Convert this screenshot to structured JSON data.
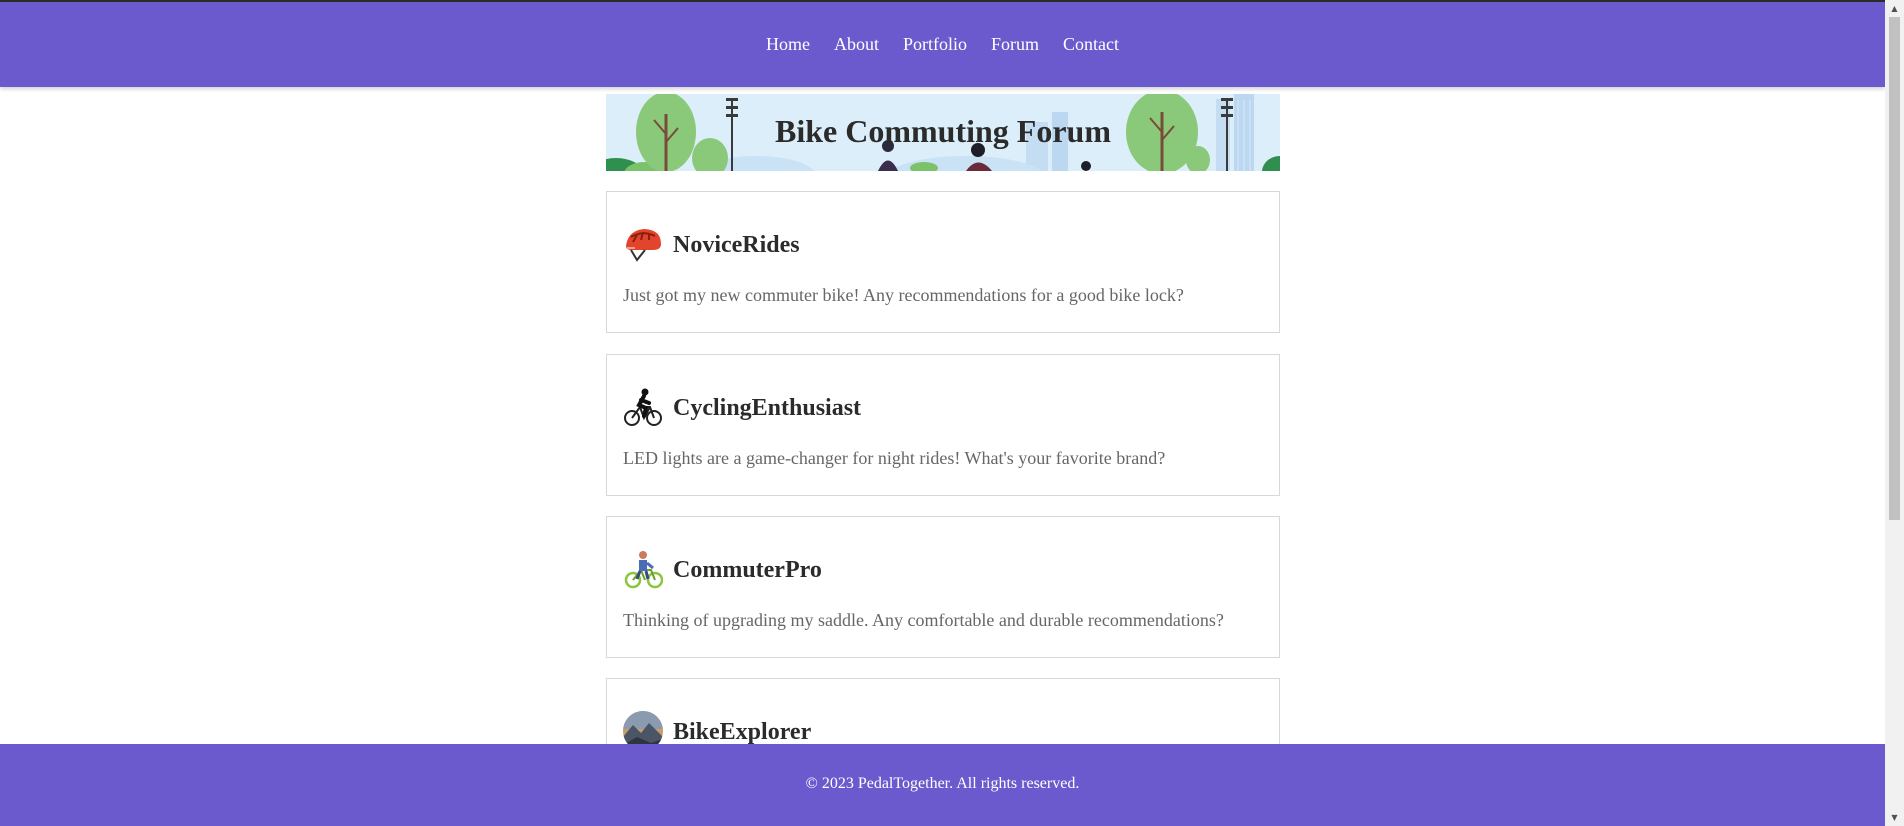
{
  "nav": {
    "items": [
      {
        "label": "Home"
      },
      {
        "label": "About"
      },
      {
        "label": "Portfolio"
      },
      {
        "label": "Forum"
      },
      {
        "label": "Contact"
      }
    ]
  },
  "banner": {
    "title": "Bike Commuting Forum"
  },
  "posts": [
    {
      "user": "NoviceRides",
      "avatar_icon": "bike-helmet-icon",
      "text": "Just got my new commuter bike! Any recommendations for a good bike lock?"
    },
    {
      "user": "CyclingEnthusiast",
      "avatar_icon": "cyclist-silhouette-icon",
      "text": "LED lights are a game-changer for night rides! What's your favorite brand?"
    },
    {
      "user": "CommuterPro",
      "avatar_icon": "cyclist-illustration-icon",
      "text": "Thinking of upgrading my saddle. Any comfortable and durable recommendations?"
    },
    {
      "user": "BikeExplorer",
      "avatar_icon": "mountain-photo-icon",
      "text": ""
    }
  ],
  "footer": {
    "text": "© 2023 PedalTogether. All rights reserved."
  },
  "colors": {
    "brand": "#6a5acd",
    "text": "#2b2b2b",
    "muted": "#666666",
    "border": "#d8d8d8"
  }
}
